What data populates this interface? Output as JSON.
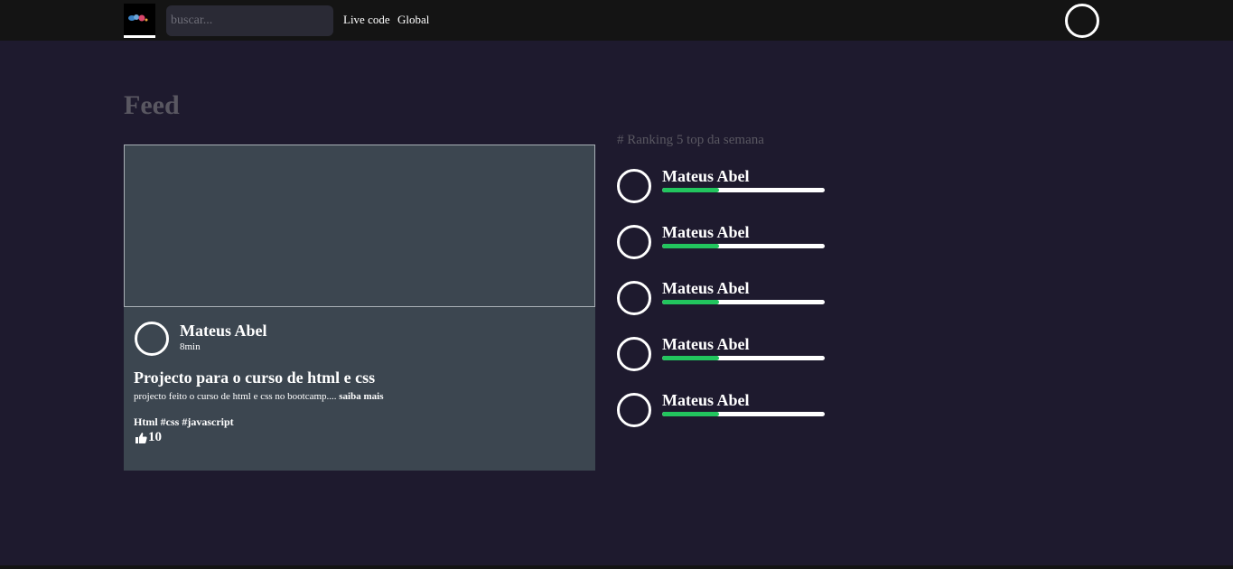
{
  "header": {
    "search_placeholder": "buscar...",
    "nav": [
      "Live code",
      "Global"
    ]
  },
  "feed": {
    "title": "Feed",
    "post": {
      "author": "Mateus Abel",
      "time": "8min",
      "title": "Projecto para o curso de html e css",
      "description": "projecto feito o curso de html e css no bootcamp....",
      "more": "saiba mais",
      "tags": "Html #css #javascript",
      "likes": "10"
    }
  },
  "ranking": {
    "title": "# Ranking 5 top da semana",
    "items": [
      {
        "name": "Mateus Abel",
        "progress": 0.35
      },
      {
        "name": "Mateus Abel",
        "progress": 0.35
      },
      {
        "name": "Mateus Abel",
        "progress": 0.35
      },
      {
        "name": "Mateus Abel",
        "progress": 0.35
      },
      {
        "name": "Mateus Abel",
        "progress": 0.35
      }
    ]
  },
  "colors": {
    "background": "#1e1a2e",
    "topbar": "#141414",
    "card": "#3c4650",
    "muted_text": "#595761",
    "progress": "#22c55e"
  },
  "icons": [
    "logo-icon",
    "thumbs-up-icon"
  ]
}
